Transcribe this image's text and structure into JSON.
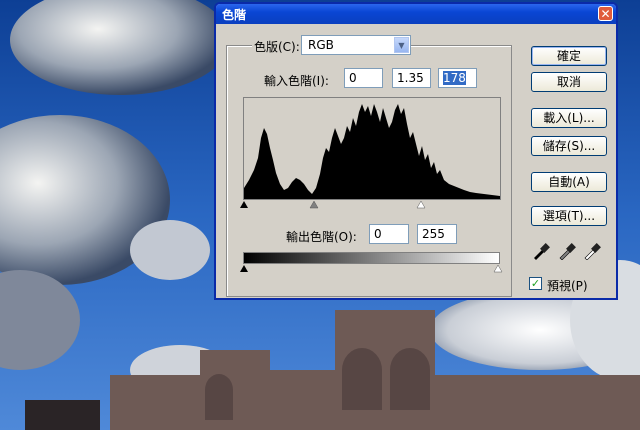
{
  "dialog": {
    "title": "色階",
    "close_symbol": "✕"
  },
  "channel": {
    "label": "色版(C):",
    "value": "RGB"
  },
  "input_levels": {
    "label": "輸入色階(I):",
    "black": "0",
    "gamma": "1.35",
    "white": "178"
  },
  "output_levels": {
    "label": "輸出色階(O):",
    "black": "0",
    "white": "255"
  },
  "buttons": {
    "ok": "確定",
    "cancel": "取消",
    "load": "載入(L)...",
    "save": "儲存(S)...",
    "auto": "自動(A)",
    "options": "選項(T)..."
  },
  "preview": {
    "label": "預視(P)",
    "checked": true
  },
  "icons": [
    "black-eyedropper-icon",
    "gray-eyedropper-icon",
    "white-eyedropper-icon"
  ]
}
